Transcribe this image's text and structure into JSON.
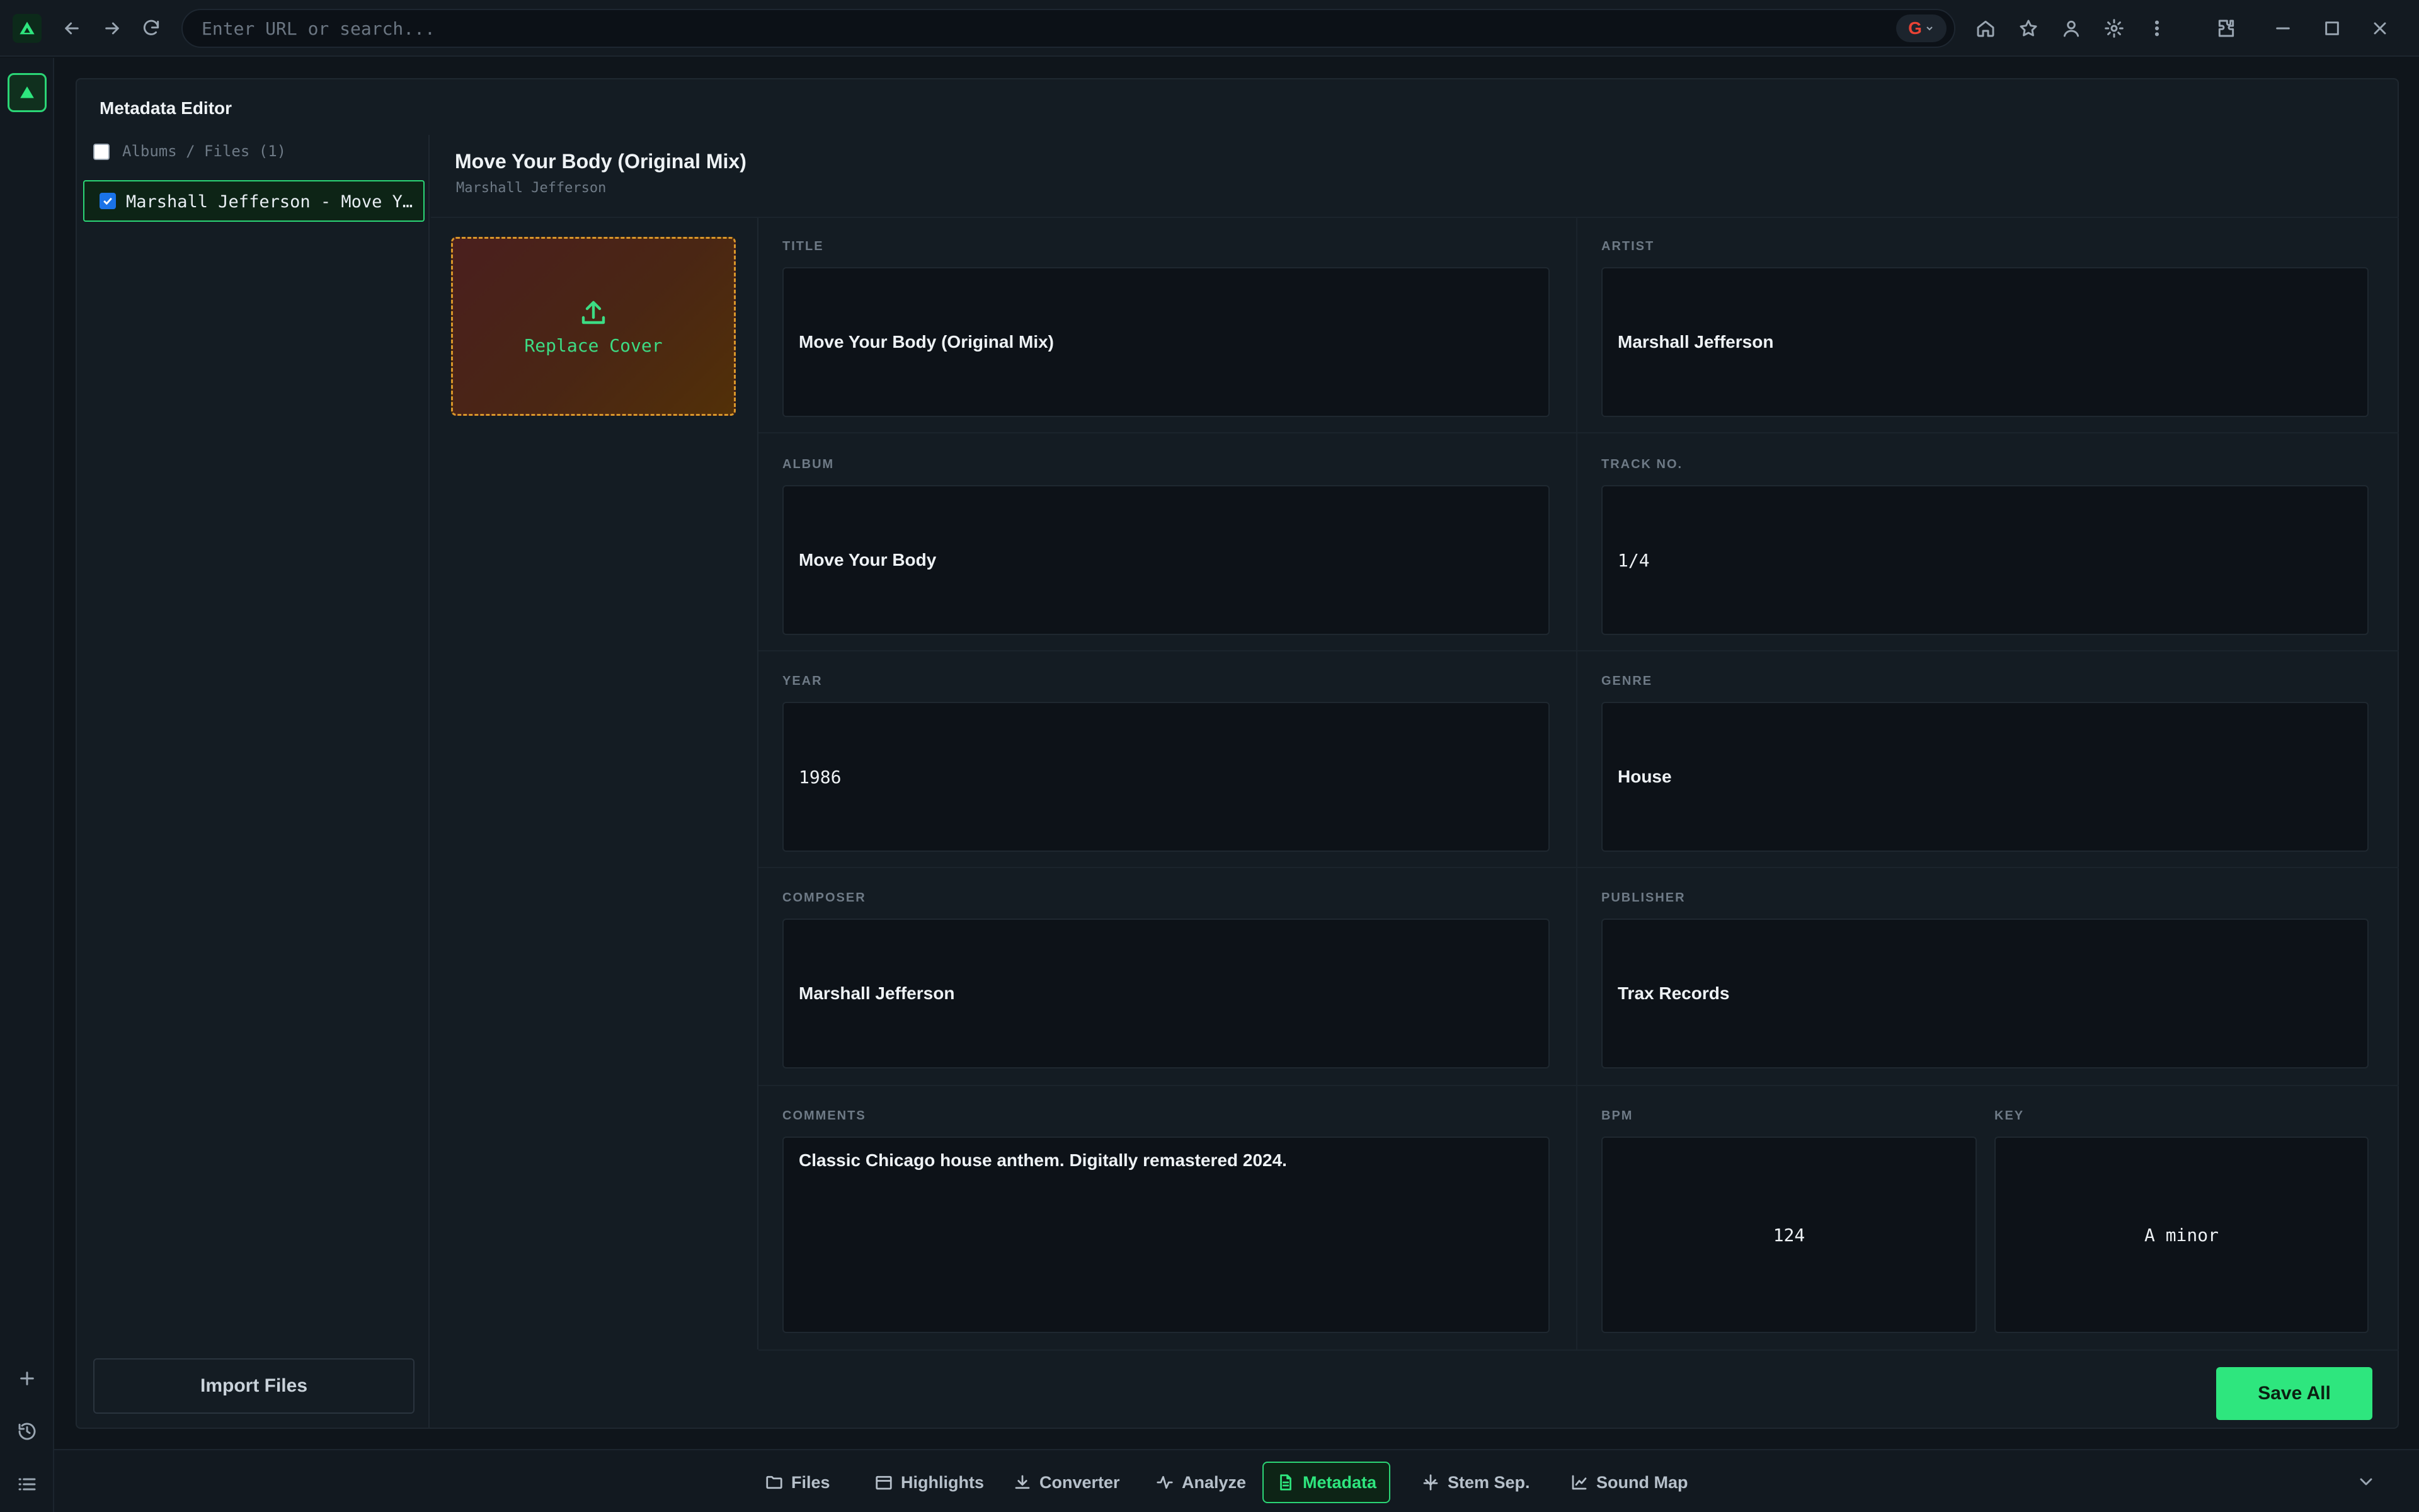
{
  "browser": {
    "url_placeholder": "Enter URL or search..."
  },
  "editor": {
    "title": "Metadata Editor",
    "files_header": "Albums / Files (1)",
    "files": [
      {
        "name": "Marshall Jefferson - Move Your Body (Original Mix)",
        "checked": true
      }
    ],
    "import_label": "Import Files"
  },
  "track": {
    "title": "Move Your Body (Original Mix)",
    "artist": "Marshall Jefferson",
    "cover_label": "Replace Cover"
  },
  "fields": {
    "title": {
      "label": "TITLE",
      "value": "Move Your Body (Original Mix)"
    },
    "artist": {
      "label": "ARTIST",
      "value": "Marshall Jefferson"
    },
    "album": {
      "label": "ALBUM",
      "value": "Move Your Body"
    },
    "track_no": {
      "label": "TRACK NO.",
      "value": "1/4"
    },
    "year": {
      "label": "YEAR",
      "value": "1986"
    },
    "genre": {
      "label": "GENRE",
      "value": "House"
    },
    "composer": {
      "label": "COMPOSER",
      "value": "Marshall Jefferson"
    },
    "publisher": {
      "label": "PUBLISHER",
      "value": "Trax Records"
    },
    "comments": {
      "label": "COMMENTS",
      "value": "Classic Chicago house anthem. Digitally remastered 2024."
    },
    "bpm": {
      "label": "BPM",
      "value": "124"
    },
    "key": {
      "label": "KEY",
      "value": "A minor"
    }
  },
  "save_label": "Save All",
  "tabs": [
    {
      "label": "Files",
      "icon": "folder-icon"
    },
    {
      "label": "Highlights",
      "icon": "calendar-icon"
    },
    {
      "label": "Converter",
      "icon": "download-icon"
    },
    {
      "label": "Analyze",
      "icon": "activity-icon"
    },
    {
      "label": "Metadata",
      "icon": "document-icon",
      "active": true
    },
    {
      "label": "Stem Sep.",
      "icon": "split-icon"
    },
    {
      "label": "Sound Map",
      "icon": "chart-icon"
    }
  ],
  "colors": {
    "accent": "#2ee67e",
    "background": "#0f151b",
    "cover_border": "#d9962a"
  }
}
